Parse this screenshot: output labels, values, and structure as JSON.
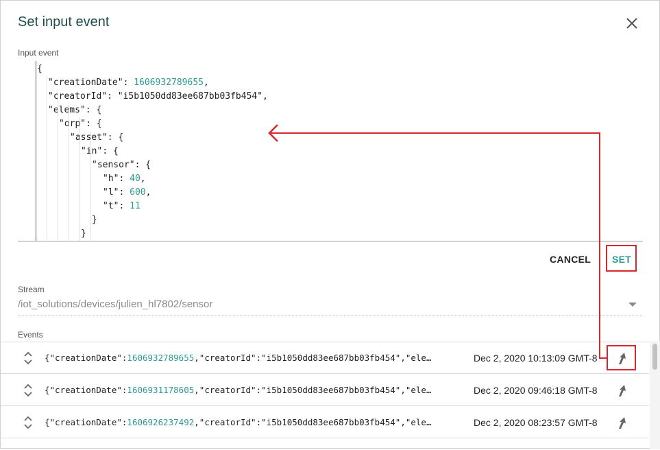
{
  "dialog": {
    "title": "Set input event",
    "input_event_label": "Input event",
    "cancel_label": "CANCEL",
    "set_label": "SET"
  },
  "editor": {
    "lines": [
      {
        "indent": 0,
        "parts": [
          {
            "t": "{",
            "c": "p"
          }
        ]
      },
      {
        "indent": 1,
        "parts": [
          {
            "t": "\"creationDate\"",
            "c": "k"
          },
          {
            "t": ": ",
            "c": "p"
          },
          {
            "t": "1606932789655",
            "c": "n"
          },
          {
            "t": ",",
            "c": "p"
          }
        ]
      },
      {
        "indent": 1,
        "parts": [
          {
            "t": "\"creatorId\"",
            "c": "k"
          },
          {
            "t": ": ",
            "c": "p"
          },
          {
            "t": "\"i5b1050dd83ee687bb03fb454\"",
            "c": "k"
          },
          {
            "t": ",",
            "c": "p"
          }
        ]
      },
      {
        "indent": 1,
        "parts": [
          {
            "t": "\"elems\"",
            "c": "k"
          },
          {
            "t": ": {",
            "c": "p"
          }
        ]
      },
      {
        "indent": 2,
        "parts": [
          {
            "t": "\"orp\"",
            "c": "k"
          },
          {
            "t": ": {",
            "c": "p"
          }
        ]
      },
      {
        "indent": 3,
        "parts": [
          {
            "t": "\"asset\"",
            "c": "k"
          },
          {
            "t": ": {",
            "c": "p"
          }
        ]
      },
      {
        "indent": 4,
        "parts": [
          {
            "t": "\"in\"",
            "c": "k"
          },
          {
            "t": ": {",
            "c": "p"
          }
        ]
      },
      {
        "indent": 5,
        "parts": [
          {
            "t": "\"sensor\"",
            "c": "k"
          },
          {
            "t": ": {",
            "c": "p"
          }
        ]
      },
      {
        "indent": 6,
        "parts": [
          {
            "t": "\"h\"",
            "c": "k"
          },
          {
            "t": ": ",
            "c": "p"
          },
          {
            "t": "40",
            "c": "n"
          },
          {
            "t": ",",
            "c": "p"
          }
        ]
      },
      {
        "indent": 6,
        "parts": [
          {
            "t": "\"l\"",
            "c": "k"
          },
          {
            "t": ": ",
            "c": "p"
          },
          {
            "t": "600",
            "c": "n"
          },
          {
            "t": ",",
            "c": "p"
          }
        ]
      },
      {
        "indent": 6,
        "parts": [
          {
            "t": "\"t\"",
            "c": "k"
          },
          {
            "t": ": ",
            "c": "p"
          },
          {
            "t": "11",
            "c": "n"
          }
        ]
      },
      {
        "indent": 5,
        "parts": [
          {
            "t": "}",
            "c": "p"
          }
        ]
      },
      {
        "indent": 4,
        "parts": [
          {
            "t": "}",
            "c": "p"
          }
        ]
      }
    ]
  },
  "stream": {
    "label": "Stream",
    "value": "/iot_solutions/devices/julien_hl7802/sensor"
  },
  "events": {
    "label": "Events",
    "items": [
      {
        "creation_date": "1606932789655",
        "creator_id": "\"i5b1050dd83ee687bb03fb454\"",
        "date": "Dec 2, 2020 10:13:09 GMT-8"
      },
      {
        "creation_date": "1606931178605",
        "creator_id": "\"i5b1050dd83ee687bb03fb454\"",
        "date": "Dec 2, 2020 09:46:18 GMT-8"
      },
      {
        "creation_date": "1606926237492",
        "creator_id": "\"i5b1050dd83ee687bb03fb454\"",
        "date": "Dec 2, 2020 08:23:57 GMT-8"
      }
    ]
  },
  "colors": {
    "accent": "#2b9a8f",
    "annotation": "#d7262c",
    "title": "#1f4e4a"
  },
  "icons": {
    "close": "close-icon",
    "sort": "unfold-icon",
    "use_event": "arrow-up-icon",
    "dropdown": "caret-down-icon"
  }
}
